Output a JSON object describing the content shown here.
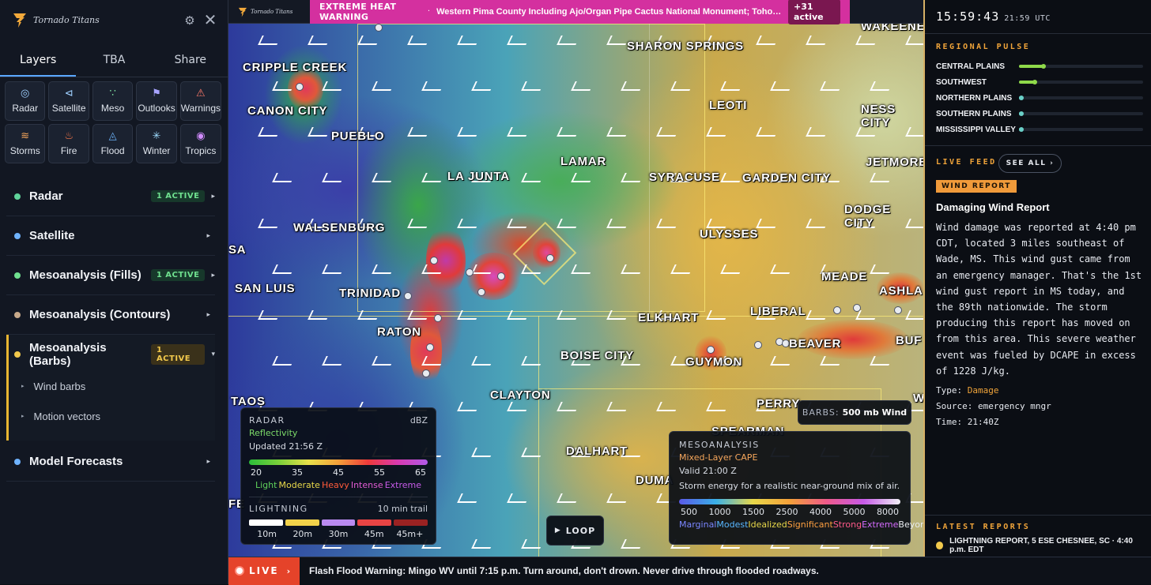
{
  "sidebar": {
    "brand": "Tornado Titans",
    "tabs": [
      "Layers",
      "TBA",
      "Share"
    ],
    "layer_buttons": [
      {
        "label": "Radar",
        "icon": "radar-icon",
        "glyph": "◎",
        "color": "#9fd0ff"
      },
      {
        "label": "Satellite",
        "icon": "satellite-icon",
        "glyph": "⊲",
        "color": "#9fd0ff"
      },
      {
        "label": "Meso",
        "icon": "meso-icon",
        "glyph": "∵",
        "color": "#7ee0a0"
      },
      {
        "label": "Outlooks",
        "icon": "flag-icon",
        "glyph": "⚑",
        "color": "#a7a3ff"
      },
      {
        "label": "Warnings",
        "icon": "warning-icon",
        "glyph": "⚠",
        "color": "#ff7a6a"
      },
      {
        "label": "Storms",
        "icon": "storms-icon",
        "glyph": "≋",
        "color": "#f5a65b"
      },
      {
        "label": "Fire",
        "icon": "fire-icon",
        "glyph": "♨",
        "color": "#ff7a4a"
      },
      {
        "label": "Flood",
        "icon": "flood-icon",
        "glyph": "◬",
        "color": "#6fb7ff"
      },
      {
        "label": "Winter",
        "icon": "snowflake-icon",
        "glyph": "✳",
        "color": "#9fdcff"
      },
      {
        "label": "Tropics",
        "icon": "hurricane-icon",
        "glyph": "◉",
        "color": "#d28cff"
      }
    ],
    "layers": [
      {
        "name": "Radar",
        "badge": "1 ACTIVE",
        "dot": "#5fd39a",
        "arrow": "▸"
      },
      {
        "name": "Satellite",
        "badge": "",
        "dot": "#6fb3ff",
        "arrow": "▸"
      },
      {
        "name": "Mesoanalysis (Fills)",
        "badge": "1 ACTIVE",
        "dot": "#6fe08f",
        "arrow": "▸"
      },
      {
        "name": "Mesoanalysis (Contours)",
        "badge": "",
        "dot": "#c7a98a",
        "arrow": "▸"
      },
      {
        "name": "Mesoanalysis (Barbs)",
        "badge": "1 ACTIVE",
        "dot": "#f2c94c",
        "arrow": "▾"
      }
    ],
    "sub_layers": [
      "Wind barbs",
      "Motion vectors"
    ],
    "model_forecasts": {
      "name": "Model Forecasts",
      "dot": "#6fb3ff",
      "arrow": "▸"
    }
  },
  "alert": {
    "logo_text": "Tornado Titans",
    "type": "EXTREME HEAT WARNING",
    "separator": "·",
    "text": "Western Pima County Including Ajo/Organ Pipe Cactus National Monument; Tohono O'odham Nation incl...",
    "count": "+31 active"
  },
  "map": {
    "cities": [
      "WAKEENEY",
      "SHARON SPRINGS",
      "CRIPPLE CREEK",
      "CANON CITY",
      "LEOTI",
      "NESS CITY",
      "PUEBLO",
      "LA JUNTA",
      "LAMAR",
      "SYRACUSE",
      "GARDEN CITY",
      "JETMORE",
      "DODGE CITY",
      "WALSENBURG",
      "ULYSSES",
      "SA",
      "MEADE",
      "SAN LUIS",
      "TRINIDAD",
      "LIBERAL",
      "ASHLA",
      "ELKHART",
      "RATON",
      "BEAVER",
      "BUF",
      "BOISE CITY",
      "GUYMON",
      "TAOS",
      "CLAYTON",
      "PERRY",
      "W",
      "SPEARMAN",
      "DALHART",
      "DUMA",
      "FE"
    ]
  },
  "radar_legend": {
    "title": "RADAR",
    "unit": "dBZ",
    "product": "Reflectivity",
    "updated": "Updated 21:56 Z",
    "ticks": [
      "20",
      "35",
      "45",
      "55",
      "65"
    ],
    "labels": [
      {
        "text": "Light",
        "color": "#5fd05a"
      },
      {
        "text": "Moderate",
        "color": "#e8d84a"
      },
      {
        "text": "Heavy",
        "color": "#ff5a3a"
      },
      {
        "text": "Intense",
        "color": "#e05ad2"
      },
      {
        "text": "Extreme",
        "color": "#c65ae8"
      }
    ],
    "lightning_title": "LIGHTNING",
    "lightning_trail": "10 min trail",
    "lightning_bins": [
      {
        "label": "10m",
        "color": "#ffffff"
      },
      {
        "label": "20m",
        "color": "#f2d24a"
      },
      {
        "label": "30m",
        "color": "#b98af0"
      },
      {
        "label": "45m",
        "color": "#e84444"
      },
      {
        "label": "45m+",
        "color": "#9a2222"
      }
    ]
  },
  "meso_legend": {
    "title": "MESOANALYSIS",
    "product": "Mixed-Layer CAPE",
    "valid": "Valid 21:00 Z",
    "description": "Storm energy for a realistic near-ground mix of air.",
    "ticks": [
      "500",
      "1000",
      "1500",
      "2500",
      "4000",
      "5000",
      "8000"
    ],
    "labels": [
      {
        "text": "Marginal",
        "color": "#7a86ff"
      },
      {
        "text": "Modest",
        "color": "#58b6ff"
      },
      {
        "text": "Idealized",
        "color": "#e8d84a"
      },
      {
        "text": "Significant",
        "color": "#ffa040"
      },
      {
        "text": "Strong",
        "color": "#ff5a8a"
      },
      {
        "text": "Extreme",
        "color": "#d56cff"
      },
      {
        "text": "Beyond",
        "color": "#e8ebf0"
      }
    ]
  },
  "barbs_chip": {
    "key": "BARBS:",
    "value": "500 mb Wind"
  },
  "loop": {
    "icon": "▶",
    "label": "LOOP"
  },
  "ticker": {
    "live": "LIVE",
    "chevron": "›",
    "text": "Flash Flood Warning: Mingo WV until 7:15 p.m. Turn around, don't drown. Never drive through flooded roadways."
  },
  "right": {
    "clock": "15:59:43",
    "utc": "21:59 UTC",
    "regional_title": "REGIONAL PULSE",
    "regions": [
      {
        "name": "CENTRAL PLAINS",
        "level": 0.2,
        "color": "#8fd94a"
      },
      {
        "name": "SOUTHWEST",
        "level": 0.13,
        "color": "#8fd94a"
      },
      {
        "name": "NORTHERN PLAINS",
        "level": 0.02,
        "color": "#6ad0c8"
      },
      {
        "name": "SOUTHERN PLAINS",
        "level": 0.02,
        "color": "#6ad0c8"
      },
      {
        "name": "MISSISSIPPI VALLEY",
        "level": 0.02,
        "color": "#6ad0c8"
      }
    ],
    "live_feed_title": "LIVE FEED",
    "see_all": "SEE ALL ›",
    "feed_tag": "WIND REPORT",
    "feed_title": "Damaging Wind Report",
    "feed_body": "Wind damage was reported at 4:40 pm CDT, located 3 miles southeast of Wade, MS. This wind gust came from an emergency manager. That's the 1st wind gust report in MS today, and the 89th nationwide. The storm producing this report has moved on from this area. This severe weather event was fueled by DCAPE in excess of 1228 J/kg.",
    "type_label": "Type:",
    "type_value": "Damage",
    "source_label": "Source:",
    "source_value": "emergency mngr",
    "time_label": "Time:",
    "time_value": "21:40Z",
    "latest_title": "LATEST REPORTS",
    "latest_item": "LIGHTNING REPORT, 5 ESE CHESNEE, SC · 4:40 p.m. EDT"
  }
}
